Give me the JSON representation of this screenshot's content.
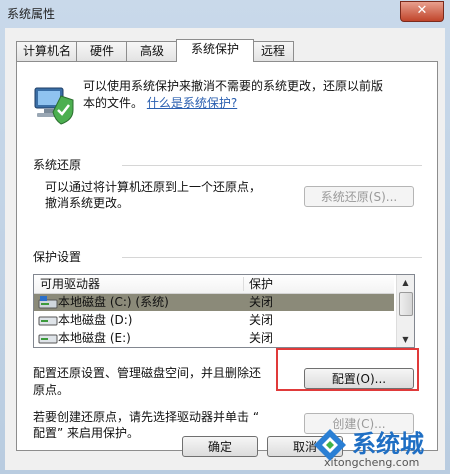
{
  "window": {
    "title": "系统属性",
    "close_glyph": "✕"
  },
  "tabs": [
    {
      "label": "计算机名"
    },
    {
      "label": "硬件"
    },
    {
      "label": "高级"
    },
    {
      "label": "系统保护"
    },
    {
      "label": "远程"
    }
  ],
  "intro": {
    "line1": "可以使用系统保护来撤消不需要的系统更改，还原以前版",
    "line2": "本的文件。",
    "link": "什么是系统保护?"
  },
  "restore": {
    "heading": "系统还原",
    "line1": "可以通过将计算机还原到上一个还原点，",
    "line2": "撤消系统更改。",
    "button": "系统还原(S)..."
  },
  "protection": {
    "heading": "保护设置",
    "columns": [
      "可用驱动器",
      "保护"
    ],
    "drives": [
      {
        "name": "本地磁盘 (C:) (系统)",
        "status": "关闭"
      },
      {
        "name": "本地磁盘 (D:)",
        "status": "关闭"
      },
      {
        "name": "本地磁盘 (E:)",
        "status": "关闭"
      }
    ]
  },
  "configure": {
    "line1": "配置还原设置、管理磁盘空间，并且删除还",
    "line2": "原点。",
    "button": "配置(O)..."
  },
  "create": {
    "line1": "若要创建还原点，请先选择驱动器并单击 “",
    "line2": "配置” 来启用保护。",
    "button": "创建(C)..."
  },
  "footer": {
    "ok": "确定",
    "cancel": "取消"
  },
  "watermark": {
    "brand": "系统城",
    "url": "xitongcheng.com"
  }
}
